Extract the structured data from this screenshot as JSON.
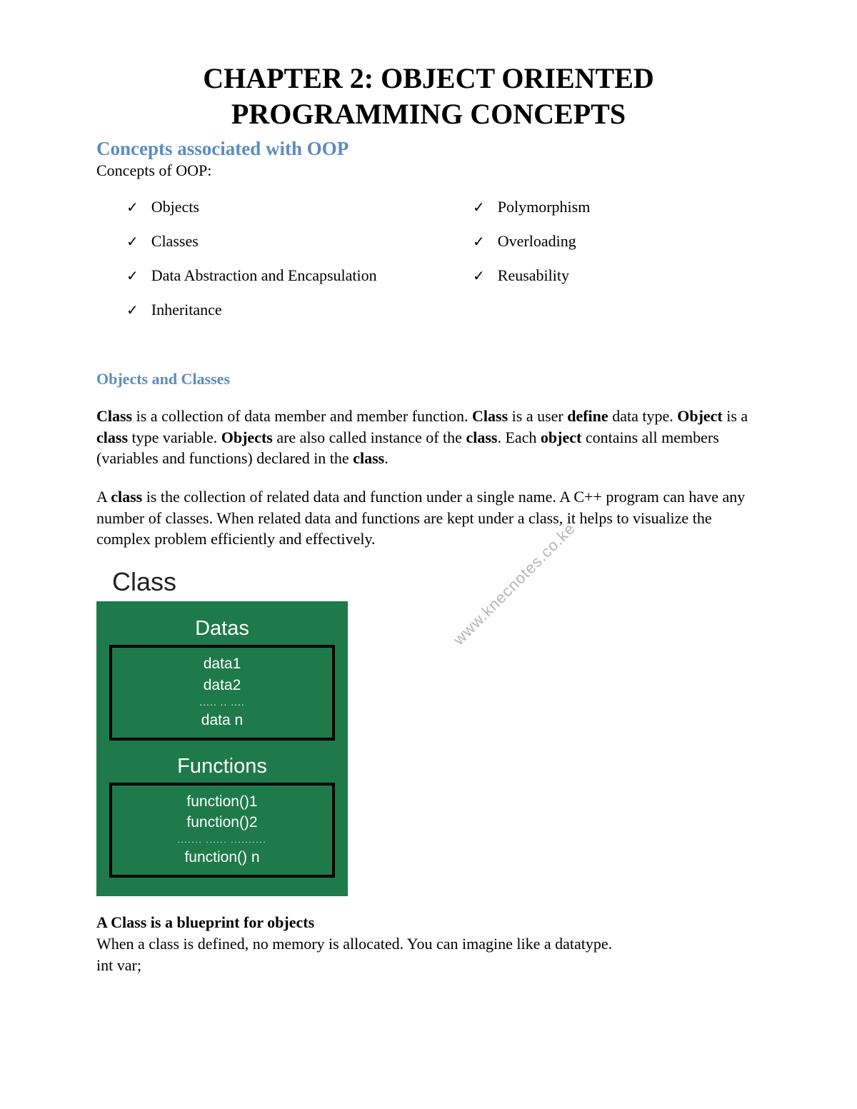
{
  "title_line1": "CHAPTER 2: OBJECT ORIENTED",
  "title_line2": "PROGRAMMING CONCEPTS",
  "section1_heading": "Concepts associated with OOP",
  "section1_sub": "Concepts of OOP:",
  "concepts_left": [
    "Objects",
    "Classes",
    "Data Abstraction and Encapsulation",
    "Inheritance"
  ],
  "concepts_right": [
    "Polymorphism",
    "Overloading",
    "Reusability"
  ],
  "section2_heading": "Objects and Classes",
  "para1_parts": {
    "b1": "Class",
    "t1": " is a collection of data member and member function. ",
    "b2": "Class",
    "t2": " is a user ",
    "b3": "define",
    "t3": " data type. ",
    "b4": "Object",
    "t4": " is a ",
    "b5": "class",
    "t5": " type variable. ",
    "b6": "Objects",
    "t6": " are also called instance of the ",
    "b7": "class",
    "t7": ". Each ",
    "b8": "object",
    "t8": " contains all members (variables and functions) declared in the ",
    "b9": "class",
    "t9": "."
  },
  "para2_parts": {
    "t0": "A ",
    "b1": "class",
    "t1": " is the collection of related data and function under a single name. A C++ program can have any number of classes. When related data and functions are kept under a class, it helps to visualize the complex problem efficiently and effectively."
  },
  "diagram": {
    "class_label": "Class",
    "datas_title": "Datas",
    "datas_items": [
      "data1",
      "data2"
    ],
    "datas_dots": "..... .. ....",
    "datas_last": "data n",
    "funcs_title": "Functions",
    "funcs_items": [
      "function()1",
      "function()2"
    ],
    "funcs_dots": "....... ...... ..........",
    "funcs_last": "function() n"
  },
  "blueprint_heading": "A Class is a blueprint for objects",
  "blueprint_line1": "When a class is defined, no memory is allocated. You can imagine like a datatype.",
  "blueprint_line2": "int var;",
  "watermark": "www.knecnotes.co.ke",
  "checkmark": "✓"
}
